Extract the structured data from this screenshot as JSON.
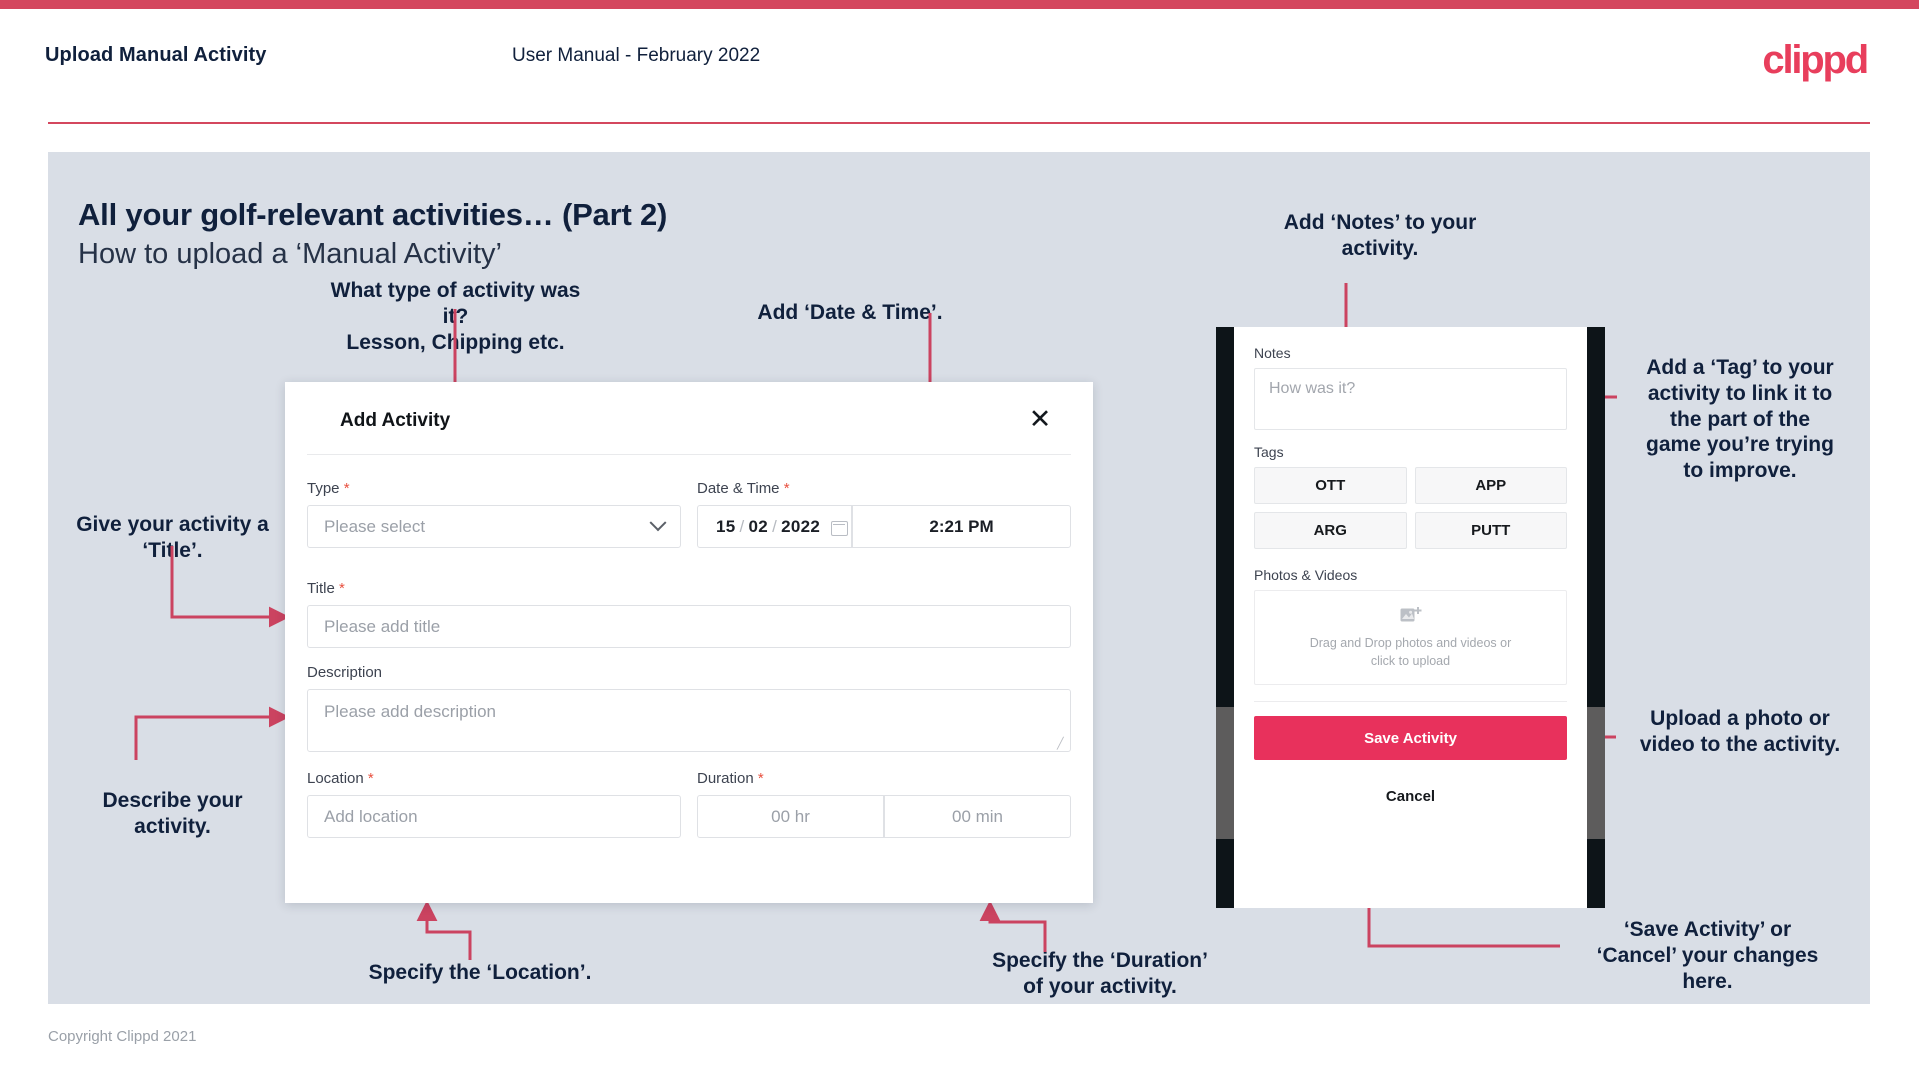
{
  "theme": {
    "accent": "#d4475e",
    "brand_pink": "#e8315c",
    "slide_bg": "#d9dee6",
    "ink": "#10203c"
  },
  "header": {
    "left_title": "Upload Manual Activity",
    "center_title": "User Manual - February 2022",
    "logo": "clippd"
  },
  "slide": {
    "title_bold": "All your golf-relevant activities… (Part 2)",
    "title_light": "How to upload a ‘Manual Activity’"
  },
  "footer": {
    "copyright": "Copyright Clippd 2021"
  },
  "annotations": {
    "type": "What type of activity was it?\nLesson, Chipping etc.",
    "datetime": "Add ‘Date & Time’.",
    "title": "Give your activity a\n‘Title’.",
    "description": "Describe your\nactivity.",
    "location": "Specify the ‘Location’.",
    "duration": "Specify the ‘Duration’\nof your activity.",
    "notes": "Add ‘Notes’ to your\nactivity.",
    "tags": "Add a ‘Tag’ to your\nactivity to link it to\nthe part of the\ngame you’re trying\nto improve.",
    "photos": "Upload a photo or\nvideo to the activity.",
    "save_cancel": "‘Save Activity’ or\n‘Cancel’ your changes\nhere."
  },
  "dialog": {
    "title": "Add Activity",
    "close_icon": "close-icon",
    "fields": {
      "type": {
        "label": "Type",
        "required": "*",
        "placeholder": "Please select"
      },
      "datetime": {
        "label": "Date & Time",
        "required": "*",
        "day": "15",
        "month": "02",
        "year": "2022",
        "sep": "/",
        "time": "2:21 PM"
      },
      "title": {
        "label": "Title",
        "required": "*",
        "placeholder": "Please add title"
      },
      "description": {
        "label": "Description",
        "placeholder": "Please add description"
      },
      "location": {
        "label": "Location",
        "required": "*",
        "placeholder": "Add location"
      },
      "duration": {
        "label": "Duration",
        "required": "*",
        "hours": "00 hr",
        "minutes": "00 min"
      }
    }
  },
  "phone": {
    "notes": {
      "label": "Notes",
      "placeholder": "How was it?"
    },
    "tags": {
      "label": "Tags",
      "items": [
        "OTT",
        "APP",
        "ARG",
        "PUTT"
      ]
    },
    "photos": {
      "label": "Photos & Videos",
      "dropzone_line1": "Drag and Drop photos and videos or",
      "dropzone_line2": "click to upload"
    },
    "save_label": "Save Activity",
    "cancel_label": "Cancel"
  }
}
